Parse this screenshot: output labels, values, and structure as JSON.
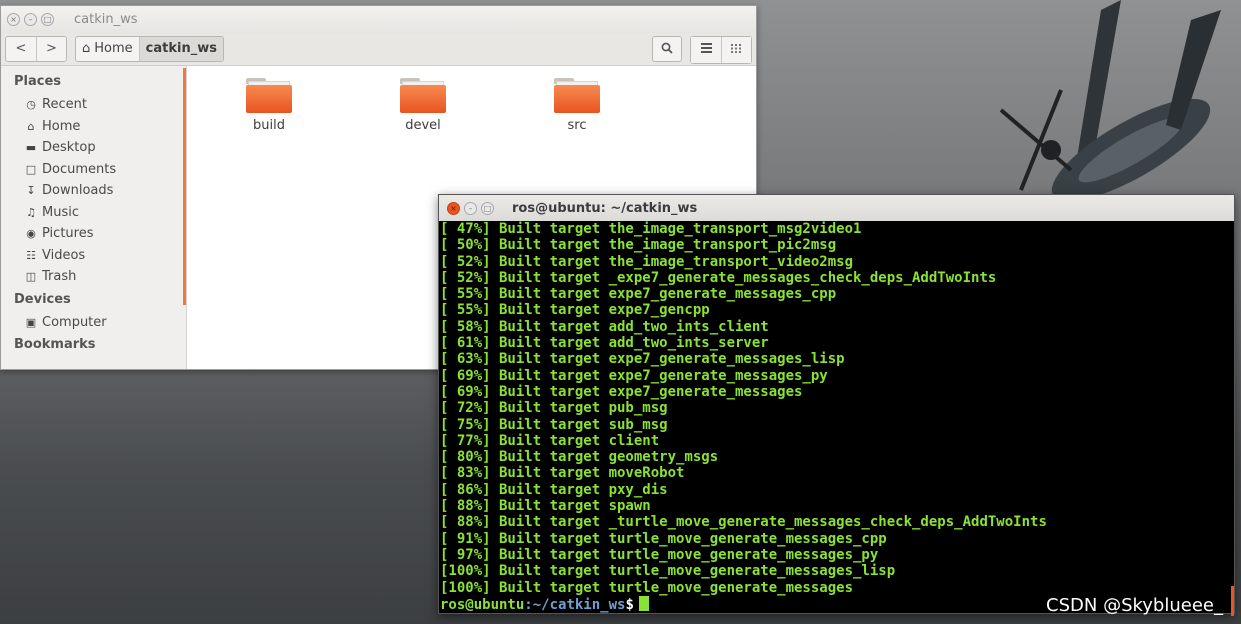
{
  "file_manager": {
    "window_title": "catkin_ws",
    "window_buttons": [
      "×",
      "–",
      "□"
    ],
    "nav": {
      "back": "<",
      "forward": ">"
    },
    "breadcrumb": [
      {
        "label": "Home",
        "icon": "home-icon"
      },
      {
        "label": "catkin_ws",
        "icon": ""
      }
    ],
    "toolbar_icons": [
      "search-icon",
      "list-view-icon",
      "grid-view-icon"
    ],
    "sidebar": {
      "sections": [
        {
          "header": "Places",
          "items": [
            {
              "label": "Recent",
              "icon": "clock-icon"
            },
            {
              "label": "Home",
              "icon": "home-icon"
            },
            {
              "label": "Desktop",
              "icon": "desktop-folder-icon"
            },
            {
              "label": "Documents",
              "icon": "document-icon"
            },
            {
              "label": "Downloads",
              "icon": "download-icon"
            },
            {
              "label": "Music",
              "icon": "music-icon"
            },
            {
              "label": "Pictures",
              "icon": "camera-icon"
            },
            {
              "label": "Videos",
              "icon": "film-icon"
            },
            {
              "label": "Trash",
              "icon": "trash-icon"
            }
          ]
        },
        {
          "header": "Devices",
          "items": [
            {
              "label": "Computer",
              "icon": "computer-icon"
            }
          ]
        },
        {
          "header": "Bookmarks",
          "items": []
        }
      ]
    },
    "folders": [
      "build",
      "devel",
      "src"
    ],
    "accent_color": "#e95420"
  },
  "terminal": {
    "window_title": "ros@ubuntu: ~/catkin_ws",
    "lines": [
      "[ 47%] Built target the_image_transport_msg2video1",
      "[ 50%] Built target the_image_transport_pic2msg",
      "[ 52%] Built target the_image_transport_video2msg",
      "[ 52%] Built target _expe7_generate_messages_check_deps_AddTwoInts",
      "[ 55%] Built target expe7_generate_messages_cpp",
      "[ 55%] Built target expe7_gencpp",
      "[ 58%] Built target add_two_ints_client",
      "[ 61%] Built target add_two_ints_server",
      "[ 63%] Built target expe7_generate_messages_lisp",
      "[ 69%] Built target expe7_generate_messages_py",
      "[ 69%] Built target expe7_generate_messages",
      "[ 72%] Built target pub_msg",
      "[ 75%] Built target sub_msg",
      "[ 77%] Built target client",
      "[ 80%] Built target geometry_msgs",
      "[ 83%] Built target moveRobot",
      "[ 86%] Built target pxy_dis",
      "[ 88%] Built target spawn",
      "[ 88%] Built target _turtle_move_generate_messages_check_deps_AddTwoInts",
      "[ 91%] Built target turtle_move_generate_messages_cpp",
      "[ 97%] Built target turtle_move_generate_messages_py",
      "[100%] Built target turtle_move_generate_messages_lisp",
      "[100%] Built target turtle_move_generate_messages"
    ],
    "prompt": {
      "user": "ros@ubuntu",
      "path": ":~/catkin_ws",
      "symbol": "$"
    },
    "text_color": "#8ae234",
    "path_color": "#729fcf"
  },
  "watermark": "CSDN @Skyblueee_"
}
